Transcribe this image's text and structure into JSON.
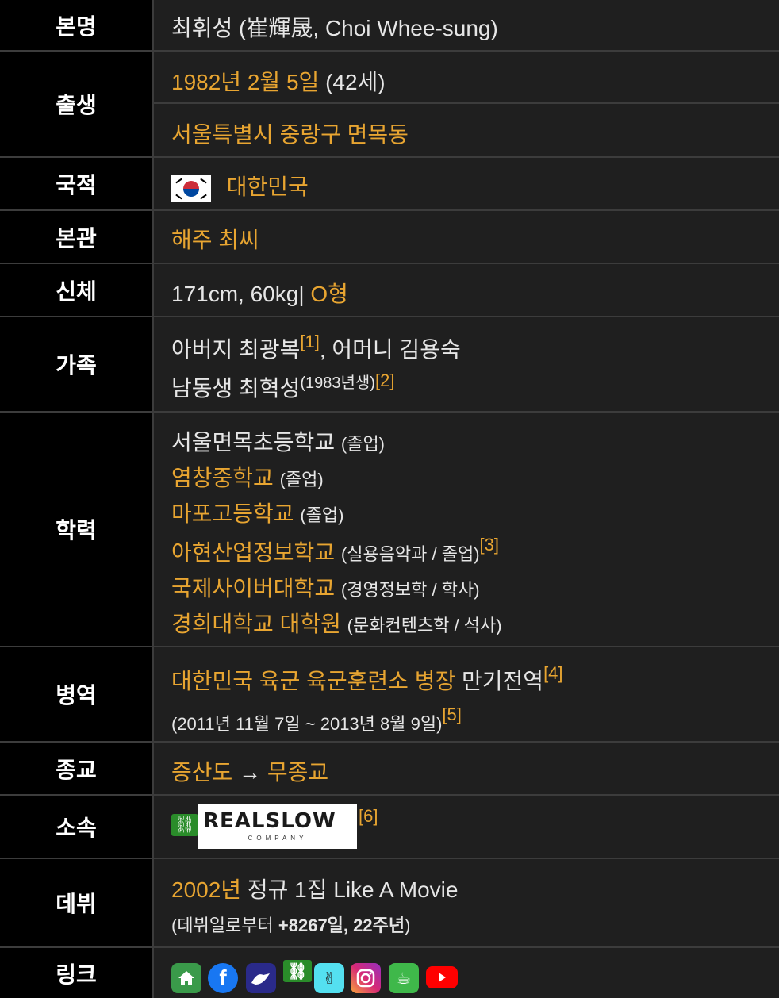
{
  "rows": {
    "name": {
      "label": "본명",
      "value": "최휘성 (崔輝晟, Choi Whee-sung)"
    },
    "birth": {
      "label": "출생",
      "date": "1982년 2월 5일",
      "age": "(42세)",
      "place": "서울특별시 중랑구 면목동"
    },
    "nationality": {
      "label": "국적",
      "value": "대한민국"
    },
    "clan": {
      "label": "본관",
      "value": "해주 최씨"
    },
    "body": {
      "label": "신체",
      "value": "171cm, 60kg|",
      "blood": "O형"
    },
    "family": {
      "label": "가족",
      "father": "아버지 최광복",
      "ref1": "[1]",
      "mother": ", 어머니 김용숙",
      "brother": "남동생 최혁성",
      "brother_year": "(1983년생)",
      "ref2": "[2]"
    },
    "education": {
      "label": "학력",
      "items": [
        {
          "school": "서울면목초등학교",
          "note": "(졸업)"
        },
        {
          "school": "염창중학교",
          "note": "(졸업)"
        },
        {
          "school": "마포고등학교",
          "note": "(졸업)"
        },
        {
          "school": "아현산업정보학교",
          "note": "(실용음악과 / 졸업)",
          "ref": "[3]"
        },
        {
          "school": "국제사이버대학교",
          "note": "(경영정보학 / 학사)"
        },
        {
          "school": "경희대학교 대학원",
          "note": "(문화컨텐츠학 / 석사)"
        }
      ]
    },
    "military": {
      "label": "병역",
      "unit": "대한민국 육군 육군훈련소 병장",
      "status": " 만기전역",
      "ref4": "[4]",
      "period": "(2011년 11월 7일 ~ 2013년 8월 9일)",
      "ref5": "[5]"
    },
    "religion": {
      "label": "종교",
      "from": "증산도",
      "arrow": " → ",
      "to": "무종교"
    },
    "agency": {
      "label": "소속",
      "logo_main": "REALSLOW",
      "logo_sub": "COMPANY",
      "ref6": "[6]"
    },
    "debut": {
      "label": "데뷔",
      "year": "2002년",
      "album": " 정규 1집 Like A Movie",
      "since_prefix": "(데뷔일로부터 ",
      "since_bold": "+8267일, 22주년",
      "since_suffix": ")"
    },
    "links": {
      "label": "링크"
    }
  },
  "colors": {
    "link": "#e8a531",
    "label_bg": "#000000",
    "value_bg": "#1f1f1f",
    "border": "#3c3c3c"
  },
  "icons": [
    "home-icon",
    "facebook-icon",
    "v-live-icon",
    "link-icon",
    "vlive-fan-icon",
    "instagram-icon",
    "kakao-cafe-icon",
    "youtube-icon"
  ]
}
